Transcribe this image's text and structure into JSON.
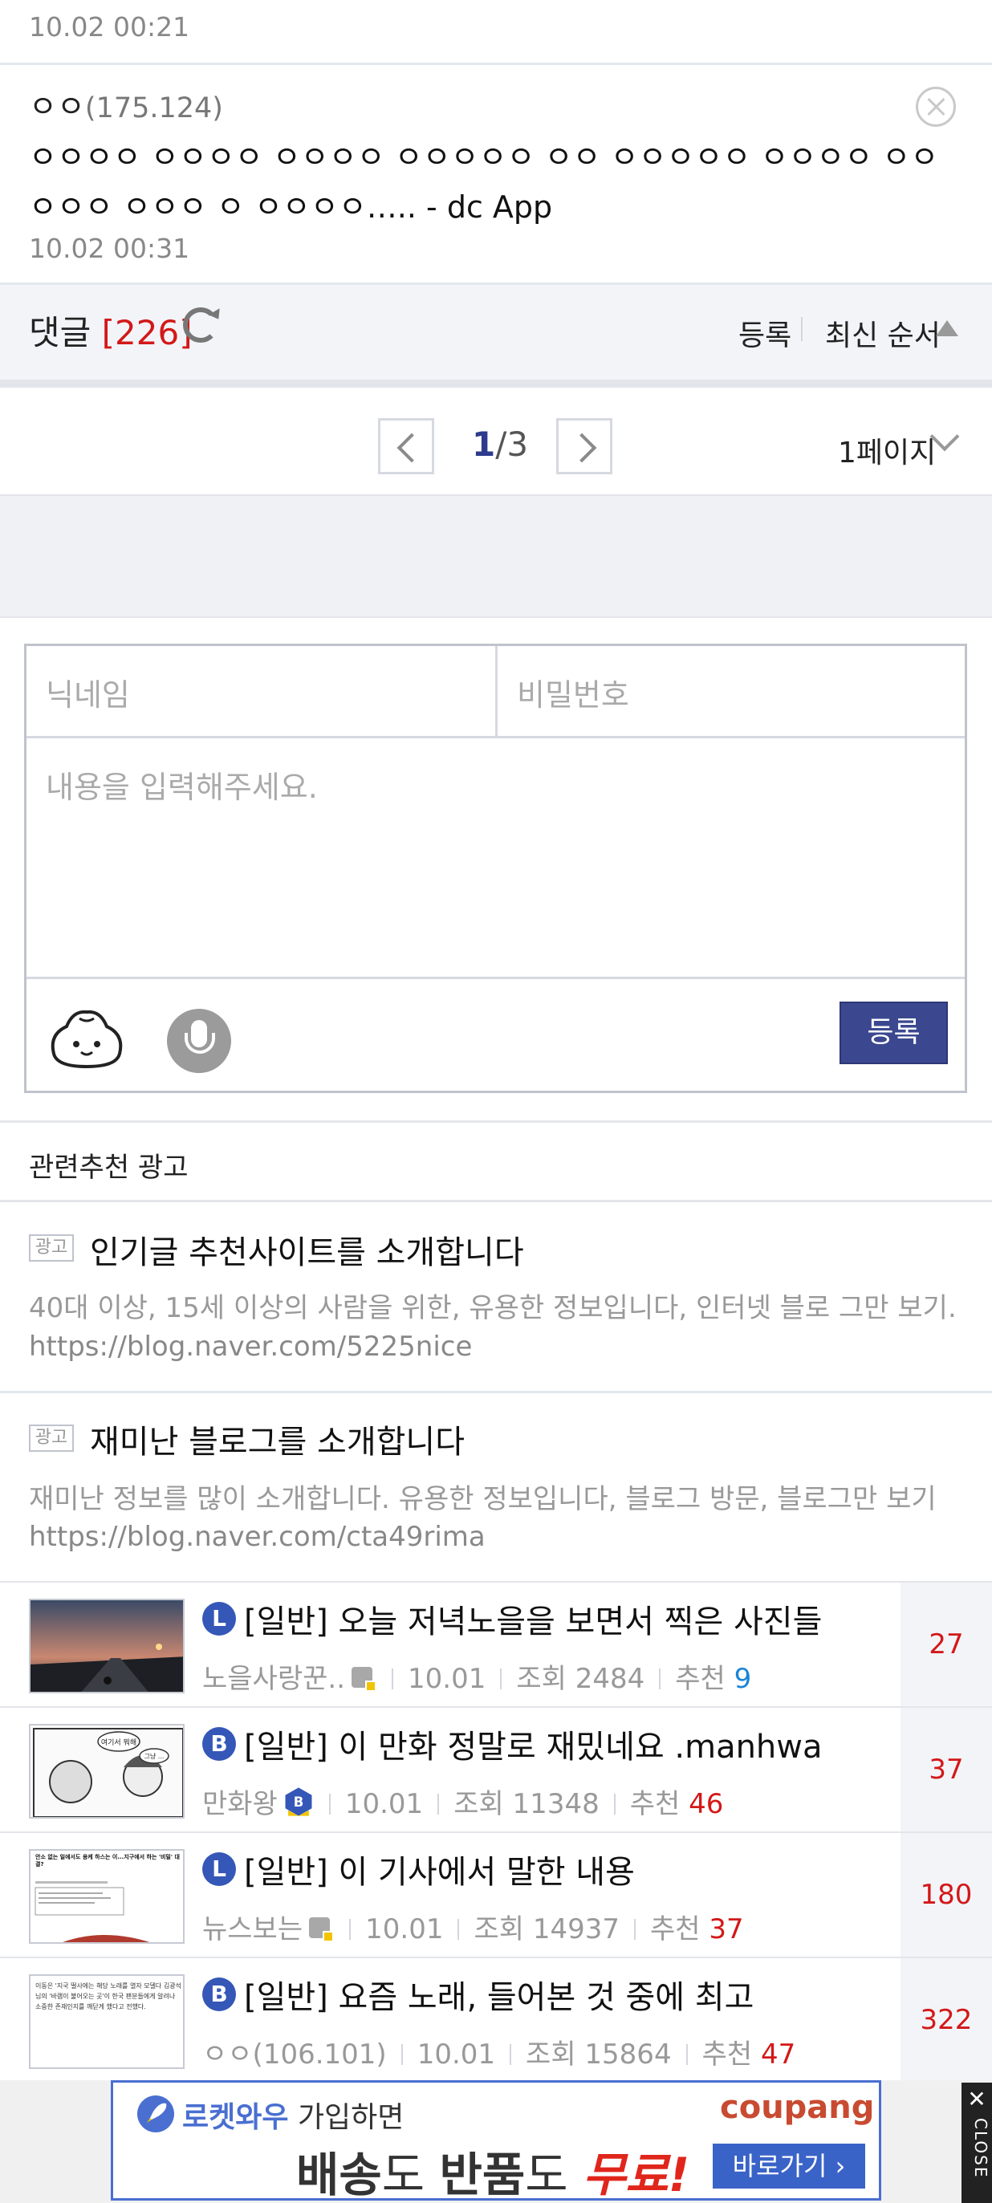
{
  "comments": [
    {
      "date": "10.02 00:21"
    },
    {
      "nick": "ㅇㅇ",
      "ip": "(175.124)",
      "text": "ㅇㅇㅇㅇ ㅇㅇㅇㅇ ㅇㅇㅇㅇ ㅇㅇㅇㅇㅇ ㅇㅇ ㅇㅇㅇㅇㅇ ㅇㅇㅇㅇ ㅇㅇㅇㅇㅇ ㅇㅇㅇ ㅇ ㅇㅇㅇㅇ….. - dc App",
      "date": "10.02 00:31"
    }
  ],
  "comment_header": {
    "label": "댓글",
    "count": "[226]",
    "sort1": "등록",
    "sort2": "최신 순서"
  },
  "pagination": {
    "current": "1",
    "total": "/3",
    "view": "1페이지"
  },
  "form": {
    "name_placeholder": "닉네임",
    "pw_placeholder": "비밀번호",
    "body_placeholder": "내용을 입력해주세요.",
    "submit": "등록"
  },
  "related": {
    "header": "관련추천 광고",
    "ads": [
      {
        "tag": "광고",
        "title": "인기글 추천사이트를 소개합니다",
        "desc": "40대 이상, 15세 이상의 사람을 위한, 유용한 정보입니다, 인터넷 블로 그만 보기.",
        "url": "https://blog.naver.com/5225nice"
      },
      {
        "tag": "광고",
        "title": "재미난 블로그를 소개합니다",
        "desc": "재미난 정보를 많이 소개합니다. 유용한 정보입니다, 블로그 방문, 블로그만 보기",
        "url": "https://blog.naver.com/cta49rima"
      }
    ]
  },
  "posts": [
    {
      "badge": "L",
      "title": "[일반] 오늘 저녁노을을 보면서 찍은 사진들",
      "author": "노을사랑꾼..",
      "date": "10.01",
      "views": "조회 2484",
      "recs": "추천",
      "recnum": "9",
      "count": "27"
    },
    {
      "badge": "B",
      "title": "[일반] 이 만화 정말로 재밌네요 .manhwa",
      "author": "만화왕",
      "date": "10.01",
      "views": "조회 11348",
      "recs": "추천",
      "recnum": "46",
      "count": "37"
    },
    {
      "badge": "L",
      "title": "[일반] 이 기사에서 말한 내용",
      "author": "뉴스보는",
      "date": "10.01",
      "views": "조회 14937",
      "recs": "추천",
      "recnum": "37",
      "count": "180"
    },
    {
      "badge": "B",
      "title": "[일반] 요즘 노래, 들어본 것 중에 최고",
      "author": "ㅇㅇ(106.101)",
      "date": "10.01",
      "views": "조회 15864",
      "recs": "추천",
      "recnum": "47",
      "count": "322"
    }
  ],
  "thumb_texts": {
    "p1": "",
    "p2_bubble1": "여기서 뭐해",
    "p2_bubble2": "그냥 ...",
    "p3_headline": "안소 없는 일에서도 용케 하스는 이...지구에서 하는 '비밀' 대결?",
    "p4_text": "이동은 '지국 떨사에는 해당 노래를 열자 모델다 김광석 님의 '바램이 불어오는 곳'이 한국 팬분들에게 알려나 소중한 존재인지를 깨닫게 했다고 전했다."
  },
  "ad": {
    "line1_brand": "로켓와우",
    "line1_rest": "가입하면",
    "coupang": "coupang",
    "line2a": "배송",
    "line2b": "도 ",
    "line2c": "반품",
    "line2d": "도 ",
    "line2e": "무료!",
    "cta": "바로가기",
    "close_x": "✕",
    "close_text": "CLOSE"
  },
  "colors": {
    "accent": "#3b4890",
    "red": "#d31818",
    "blue": "#1a84d6",
    "badge": "#3557b7"
  }
}
